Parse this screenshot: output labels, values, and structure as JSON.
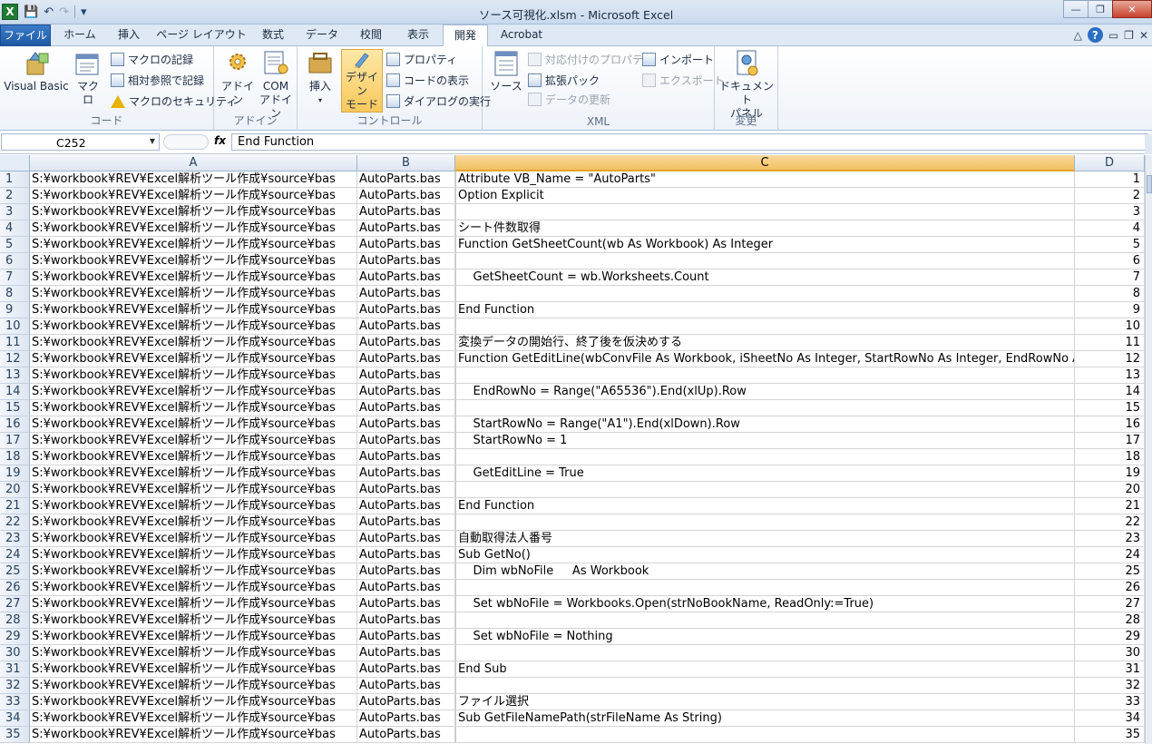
{
  "window": {
    "title": "ソース可視化.xlsm - Microsoft Excel",
    "app_icon": "X",
    "controls": {
      "minimize": "—",
      "restore": "❐",
      "close": "✕"
    }
  },
  "quick_access": {
    "save": "💾",
    "undo": "↶",
    "redo": "↷",
    "customize": "▾"
  },
  "tabs": [
    "ファイル",
    "ホーム",
    "挿入",
    "ページ レイアウト",
    "数式",
    "データ",
    "校閲",
    "表示",
    "開発",
    "Acrobat"
  ],
  "active_tab": "開発",
  "ribbon": {
    "code": {
      "label": "コード",
      "visual_basic": "Visual Basic",
      "macro": "マクロ",
      "record_macro": "マクロの記録",
      "relative_ref": "相対参照で記録",
      "macro_security": "マクロのセキュリティ"
    },
    "addins": {
      "label": "アドイン",
      "addin": "アドイン",
      "com_addin_1": "COM",
      "com_addin_2": "アドイン"
    },
    "controls": {
      "label": "コントロール",
      "insert": "挿入",
      "design_mode_1": "デザイン",
      "design_mode_2": "モード",
      "properties": "プロパティ",
      "view_code": "コードの表示",
      "run_dialog": "ダイアログの実行"
    },
    "xml": {
      "label": "XML",
      "source": "ソース",
      "map_properties": "対応付けのプロパティ",
      "expansion_packs": "拡張パック",
      "refresh_data": "データの更新",
      "import": "インポート",
      "export": "エクスポート"
    },
    "modify": {
      "label": "変更",
      "doc_panel_1": "ドキュメント",
      "doc_panel_2": "パネル"
    }
  },
  "formula_bar": {
    "name_box": "C252",
    "fx": "fx",
    "content": "End Function"
  },
  "columns": [
    "A",
    "B",
    "C",
    "D"
  ],
  "selected_column": "C",
  "rows": [
    {
      "n": "1",
      "a": "S:¥workbook¥REV¥Excel解析ツール作成¥source¥bas",
      "b": "AutoParts.bas",
      "c": "Attribute VB_Name = \"AutoParts\"",
      "d": "1"
    },
    {
      "n": "2",
      "a": "S:¥workbook¥REV¥Excel解析ツール作成¥source¥bas",
      "b": "AutoParts.bas",
      "c": "Option Explicit",
      "d": "2"
    },
    {
      "n": "3",
      "a": "S:¥workbook¥REV¥Excel解析ツール作成¥source¥bas",
      "b": "AutoParts.bas",
      "c": "",
      "d": "3"
    },
    {
      "n": "4",
      "a": "S:¥workbook¥REV¥Excel解析ツール作成¥source¥bas",
      "b": "AutoParts.bas",
      "c": "シート件数取得",
      "d": "4"
    },
    {
      "n": "5",
      "a": "S:¥workbook¥REV¥Excel解析ツール作成¥source¥bas",
      "b": "AutoParts.bas",
      "c": "Function GetSheetCount(wb As Workbook) As Integer",
      "d": "5"
    },
    {
      "n": "6",
      "a": "S:¥workbook¥REV¥Excel解析ツール作成¥source¥bas",
      "b": "AutoParts.bas",
      "c": "",
      "d": "6"
    },
    {
      "n": "7",
      "a": "S:¥workbook¥REV¥Excel解析ツール作成¥source¥bas",
      "b": "AutoParts.bas",
      "c": "    GetSheetCount = wb.Worksheets.Count",
      "d": "7"
    },
    {
      "n": "8",
      "a": "S:¥workbook¥REV¥Excel解析ツール作成¥source¥bas",
      "b": "AutoParts.bas",
      "c": "",
      "d": "8"
    },
    {
      "n": "9",
      "a": "S:¥workbook¥REV¥Excel解析ツール作成¥source¥bas",
      "b": "AutoParts.bas",
      "c": "End Function",
      "d": "9"
    },
    {
      "n": "10",
      "a": "S:¥workbook¥REV¥Excel解析ツール作成¥source¥bas",
      "b": "AutoParts.bas",
      "c": "",
      "d": "10"
    },
    {
      "n": "11",
      "a": "S:¥workbook¥REV¥Excel解析ツール作成¥source¥bas",
      "b": "AutoParts.bas",
      "c": "変換データの開始行、終了後を仮決めする",
      "d": "11"
    },
    {
      "n": "12",
      "a": "S:¥workbook¥REV¥Excel解析ツール作成¥source¥bas",
      "b": "AutoParts.bas",
      "c": "Function GetEditLine(wbConvFile As Workbook, iSheetNo As Integer, StartRowNo As Integer, EndRowNo A",
      "d": "12"
    },
    {
      "n": "13",
      "a": "S:¥workbook¥REV¥Excel解析ツール作成¥source¥bas",
      "b": "AutoParts.bas",
      "c": "",
      "d": "13"
    },
    {
      "n": "14",
      "a": "S:¥workbook¥REV¥Excel解析ツール作成¥source¥bas",
      "b": "AutoParts.bas",
      "c": "    EndRowNo = Range(\"A65536\").End(xlUp).Row",
      "d": "14"
    },
    {
      "n": "15",
      "a": "S:¥workbook¥REV¥Excel解析ツール作成¥source¥bas",
      "b": "AutoParts.bas",
      "c": "",
      "d": "15"
    },
    {
      "n": "16",
      "a": "S:¥workbook¥REV¥Excel解析ツール作成¥source¥bas",
      "b": "AutoParts.bas",
      "c": "    StartRowNo = Range(\"A1\").End(xlDown).Row",
      "d": "16"
    },
    {
      "n": "17",
      "a": "S:¥workbook¥REV¥Excel解析ツール作成¥source¥bas",
      "b": "AutoParts.bas",
      "c": "    StartRowNo = 1",
      "d": "17"
    },
    {
      "n": "18",
      "a": "S:¥workbook¥REV¥Excel解析ツール作成¥source¥bas",
      "b": "AutoParts.bas",
      "c": "",
      "d": "18"
    },
    {
      "n": "19",
      "a": "S:¥workbook¥REV¥Excel解析ツール作成¥source¥bas",
      "b": "AutoParts.bas",
      "c": "    GetEditLine = True",
      "d": "19"
    },
    {
      "n": "20",
      "a": "S:¥workbook¥REV¥Excel解析ツール作成¥source¥bas",
      "b": "AutoParts.bas",
      "c": "",
      "d": "20"
    },
    {
      "n": "21",
      "a": "S:¥workbook¥REV¥Excel解析ツール作成¥source¥bas",
      "b": "AutoParts.bas",
      "c": "End Function",
      "d": "21"
    },
    {
      "n": "22",
      "a": "S:¥workbook¥REV¥Excel解析ツール作成¥source¥bas",
      "b": "AutoParts.bas",
      "c": "",
      "d": "22"
    },
    {
      "n": "23",
      "a": "S:¥workbook¥REV¥Excel解析ツール作成¥source¥bas",
      "b": "AutoParts.bas",
      "c": "自動取得法人番号",
      "d": "23"
    },
    {
      "n": "24",
      "a": "S:¥workbook¥REV¥Excel解析ツール作成¥source¥bas",
      "b": "AutoParts.bas",
      "c": "Sub GetNo()",
      "d": "24"
    },
    {
      "n": "25",
      "a": "S:¥workbook¥REV¥Excel解析ツール作成¥source¥bas",
      "b": "AutoParts.bas",
      "c": "    Dim wbNoFile     As Workbook",
      "d": "25"
    },
    {
      "n": "26",
      "a": "S:¥workbook¥REV¥Excel解析ツール作成¥source¥bas",
      "b": "AutoParts.bas",
      "c": "",
      "d": "26"
    },
    {
      "n": "27",
      "a": "S:¥workbook¥REV¥Excel解析ツール作成¥source¥bas",
      "b": "AutoParts.bas",
      "c": "    Set wbNoFile = Workbooks.Open(strNoBookName, ReadOnly:=True)",
      "d": "27"
    },
    {
      "n": "28",
      "a": "S:¥workbook¥REV¥Excel解析ツール作成¥source¥bas",
      "b": "AutoParts.bas",
      "c": "",
      "d": "28"
    },
    {
      "n": "29",
      "a": "S:¥workbook¥REV¥Excel解析ツール作成¥source¥bas",
      "b": "AutoParts.bas",
      "c": "    Set wbNoFile = Nothing",
      "d": "29"
    },
    {
      "n": "30",
      "a": "S:¥workbook¥REV¥Excel解析ツール作成¥source¥bas",
      "b": "AutoParts.bas",
      "c": "",
      "d": "30"
    },
    {
      "n": "31",
      "a": "S:¥workbook¥REV¥Excel解析ツール作成¥source¥bas",
      "b": "AutoParts.bas",
      "c": "End Sub",
      "d": "31"
    },
    {
      "n": "32",
      "a": "S:¥workbook¥REV¥Excel解析ツール作成¥source¥bas",
      "b": "AutoParts.bas",
      "c": "",
      "d": "32"
    },
    {
      "n": "33",
      "a": "S:¥workbook¥REV¥Excel解析ツール作成¥source¥bas",
      "b": "AutoParts.bas",
      "c": "ファイル選択",
      "d": "33"
    },
    {
      "n": "34",
      "a": "S:¥workbook¥REV¥Excel解析ツール作成¥source¥bas",
      "b": "AutoParts.bas",
      "c": "Sub GetFileNamePath(strFileName As String)",
      "d": "34"
    },
    {
      "n": "35",
      "a": "S:¥workbook¥REV¥Excel解析ツール作成¥source¥bas",
      "b": "AutoParts.bas",
      "c": "",
      "d": "35"
    }
  ]
}
